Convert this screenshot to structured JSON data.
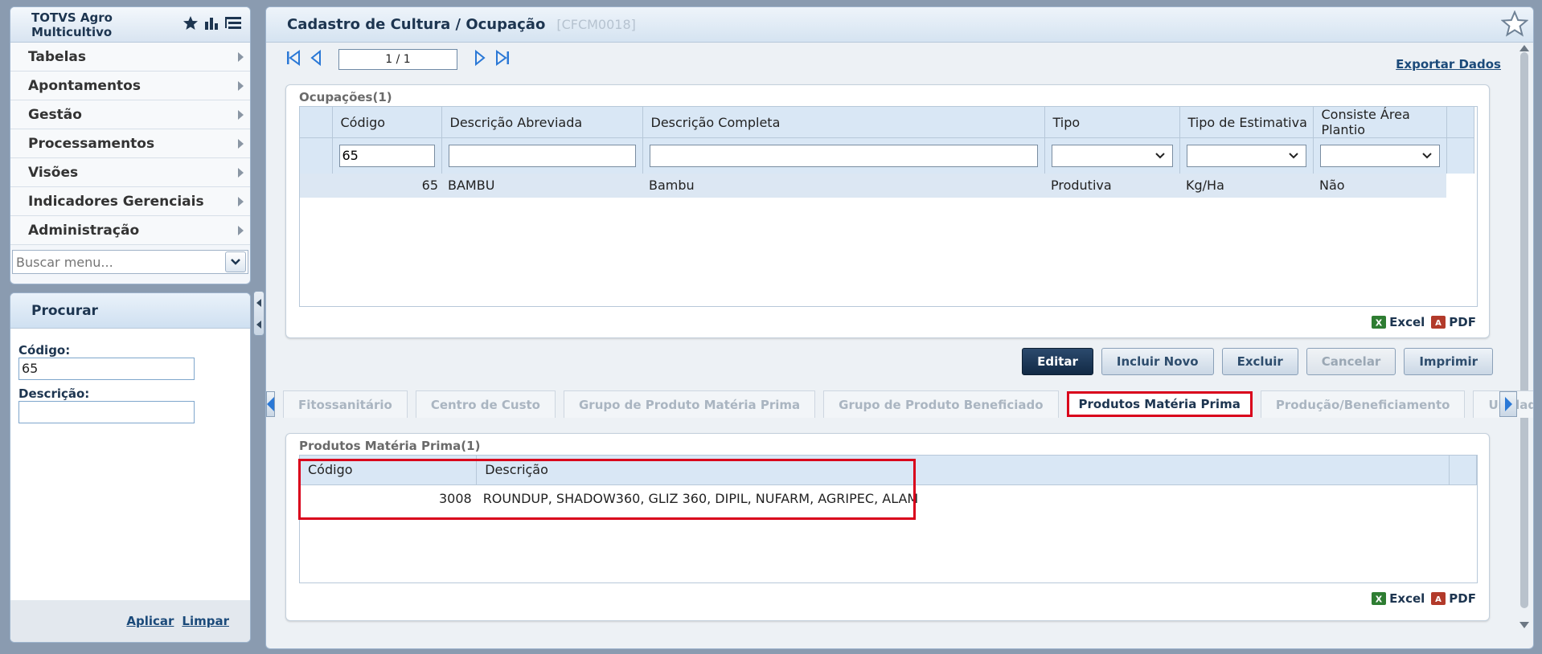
{
  "menu": {
    "title": "TOTVS Agro Multicultivo",
    "items": [
      {
        "label": "Tabelas"
      },
      {
        "label": "Apontamentos"
      },
      {
        "label": "Gestão"
      },
      {
        "label": "Processamentos"
      },
      {
        "label": "Visões"
      },
      {
        "label": "Indicadores Gerenciais"
      },
      {
        "label": "Administração"
      }
    ],
    "search_placeholder": "Buscar menu..."
  },
  "search": {
    "title": "Procurar",
    "codigo_label": "Código:",
    "codigo_value": "65",
    "descricao_label": "Descrição:",
    "descricao_value": "",
    "apply": "Aplicar",
    "clear": "Limpar"
  },
  "page": {
    "title": "Cadastro de Cultura / Ocupação",
    "code": "[CFCM0018]",
    "pager": "1 / 1",
    "export": "Exportar Dados"
  },
  "ocupacoes": {
    "title": "Ocupações(1)",
    "columns": [
      "Código",
      "Descrição Abreviada",
      "Descrição Completa",
      "Tipo",
      "Tipo de Estimativa",
      "Consiste Área Plantio"
    ],
    "filter_codigo": "65",
    "rows": [
      {
        "codigo": "65",
        "abreviada": "BAMBU",
        "completa": "Bambu",
        "tipo": "Produtiva",
        "estimativa": "Kg/Ha",
        "consiste": "Não"
      }
    ]
  },
  "exports": {
    "excel": "Excel",
    "pdf": "PDF"
  },
  "actions": {
    "edit": "Editar",
    "new": "Incluir Novo",
    "delete": "Excluir",
    "cancel": "Cancelar",
    "print": "Imprimir"
  },
  "tabs": [
    {
      "label": "Fitossanitário"
    },
    {
      "label": "Centro de Custo"
    },
    {
      "label": "Grupo de Produto Matéria Prima"
    },
    {
      "label": "Grupo de Produto Beneficiado"
    },
    {
      "label": "Produtos Matéria Prima"
    },
    {
      "label": "Produção/Beneficiamento"
    },
    {
      "label": "Unidades"
    }
  ],
  "produtos": {
    "title": "Produtos Matéria Prima(1)",
    "columns": [
      "Código",
      "Descrição"
    ],
    "rows": [
      {
        "codigo": "3008",
        "descricao": "ROUNDUP, SHADOW360, GLIZ 360, DIPIL, NUFARM, AGRIPEC, ALAM"
      }
    ]
  },
  "colors": {
    "accent": "#1d3550",
    "highlight": "#d9001b",
    "primary_button": "#1a3455"
  }
}
